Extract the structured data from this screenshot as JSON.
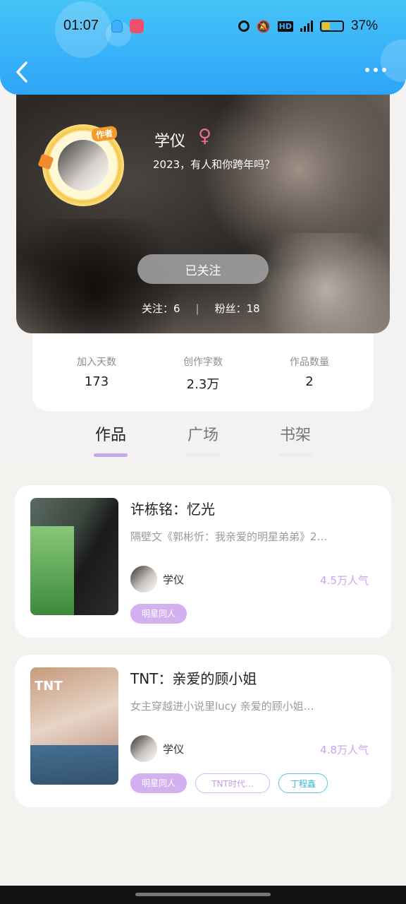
{
  "status_bar": {
    "time": "01:07",
    "battery": "37%"
  },
  "profile": {
    "author_badge": "作者",
    "name": "学仪",
    "gender_symbol": "♀",
    "bio": "2023，有人和你跨年吗？",
    "follow_button": "已关注",
    "following": "关注：6",
    "followers": "粉丝：18"
  },
  "stats": [
    {
      "label": "加入天数",
      "value": "173"
    },
    {
      "label": "创作字数",
      "value": "2.3万"
    },
    {
      "label": "作品数量",
      "value": "2"
    }
  ],
  "tabs": [
    {
      "label": "作品",
      "active": true
    },
    {
      "label": "广场",
      "active": false
    },
    {
      "label": "书架",
      "active": false
    }
  ],
  "books": [
    {
      "title": "许栋铭：忆光",
      "description": "隔壁文《郭彬忻：我亲爱的明星弟弟》2…",
      "author": "学仪",
      "popularity": "4.5万人气",
      "tags": [
        "明星同人"
      ]
    },
    {
      "cover_text": "TNT",
      "title": "TNT：亲爱的顾小姐",
      "description": "女主穿越进小说里lucy 亲爱的顾小姐…",
      "author": "学仪",
      "popularity": "4.8万人气",
      "tags": [
        "明星同人",
        "TNT时代…",
        "丁程鑫"
      ]
    }
  ],
  "colors": {
    "header": "#2ea5f8",
    "accent_purple": "#c7a8f0",
    "gender_pink": "#f36b8e",
    "tag_blue": "#3eb7d3"
  }
}
